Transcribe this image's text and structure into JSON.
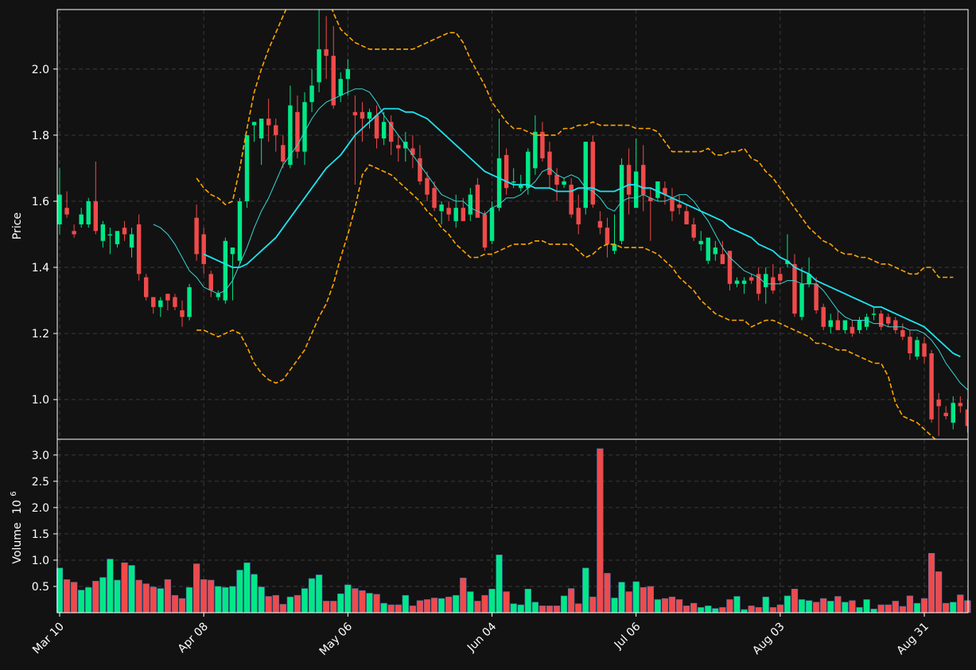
{
  "chart_data": {
    "type": "candlestick",
    "panels": {
      "price": {
        "ylabel": "Price",
        "ylim": [
          0.88,
          2.18
        ],
        "yticks": [
          1.0,
          1.2,
          1.4,
          1.6,
          1.8,
          2.0
        ],
        "ytick_labels": [
          "1.0",
          "1.2",
          "1.4",
          "1.6",
          "1.8",
          "2.0"
        ]
      },
      "volume": {
        "ylabel": "Volume",
        "ylabel_exponent": "6",
        "ylabel_base": "10",
        "ylim": [
          0,
          3.3
        ],
        "yticks": [
          0.5,
          1.0,
          1.5,
          2.0,
          2.5,
          3.0
        ],
        "ytick_labels": [
          "0.5",
          "1.0",
          "1.5",
          "2.0",
          "2.5",
          "3.0"
        ]
      }
    },
    "x_ticks": [
      {
        "index": 0,
        "label": "Mar 10"
      },
      {
        "index": 20,
        "label": "Apr 08"
      },
      {
        "index": 40,
        "label": "May 06"
      },
      {
        "index": 60,
        "label": "Jun 04"
      },
      {
        "index": 80,
        "label": "Jul 06"
      },
      {
        "index": 100,
        "label": "Aug 03"
      },
      {
        "index": 120,
        "label": "Aug 31"
      }
    ],
    "grid": true,
    "colors": {
      "background": "#121212",
      "up": "#00e887",
      "down": "#f04a4a",
      "ma_fast": "#38d5d5",
      "ma_slow": "#1ee3ee",
      "bands": "#ffa500",
      "grid": "#3a3a3a",
      "axis": "#ffffff"
    },
    "ohlc": [
      [
        1.53,
        1.7,
        1.5,
        1.62
      ],
      [
        1.58,
        1.63,
        1.55,
        1.56
      ],
      [
        1.51,
        1.53,
        1.49,
        1.5
      ],
      [
        1.53,
        1.58,
        1.52,
        1.56
      ],
      [
        1.53,
        1.61,
        1.52,
        1.6
      ],
      [
        1.6,
        1.72,
        1.5,
        1.51
      ],
      [
        1.48,
        1.54,
        1.46,
        1.53
      ],
      [
        1.5,
        1.52,
        1.44,
        1.5
      ],
      [
        1.47,
        1.51,
        1.46,
        1.51
      ],
      [
        1.52,
        1.54,
        1.48,
        1.5
      ],
      [
        1.46,
        1.52,
        1.43,
        1.5
      ],
      [
        1.53,
        1.56,
        1.36,
        1.38
      ],
      [
        1.37,
        1.38,
        1.3,
        1.31
      ],
      [
        1.31,
        1.31,
        1.26,
        1.28
      ],
      [
        1.28,
        1.31,
        1.25,
        1.3
      ],
      [
        1.32,
        1.32,
        1.27,
        1.3
      ],
      [
        1.31,
        1.32,
        1.27,
        1.28
      ],
      [
        1.27,
        1.3,
        1.22,
        1.25
      ],
      [
        1.25,
        1.35,
        1.24,
        1.34
      ],
      [
        1.55,
        1.59,
        1.42,
        1.44
      ],
      [
        1.5,
        1.52,
        1.38,
        1.41
      ],
      [
        1.38,
        1.39,
        1.31,
        1.33
      ],
      [
        1.31,
        1.33,
        1.3,
        1.32
      ],
      [
        1.3,
        1.49,
        1.29,
        1.48
      ],
      [
        1.44,
        1.46,
        1.3,
        1.46
      ],
      [
        1.42,
        1.61,
        1.41,
        1.6
      ],
      [
        1.6,
        1.8,
        1.58,
        1.8
      ],
      [
        1.83,
        1.84,
        1.78,
        1.84
      ],
      [
        1.79,
        1.85,
        1.71,
        1.85
      ],
      [
        1.85,
        1.91,
        1.78,
        1.83
      ],
      [
        1.83,
        1.85,
        1.75,
        1.8
      ],
      [
        1.77,
        1.8,
        1.7,
        1.72
      ],
      [
        1.71,
        1.95,
        1.7,
        1.89
      ],
      [
        1.87,
        1.92,
        1.73,
        1.75
      ],
      [
        1.75,
        1.93,
        1.71,
        1.9
      ],
      [
        1.9,
        2.0,
        1.87,
        1.95
      ],
      [
        1.96,
        2.2,
        1.93,
        2.06
      ],
      [
        2.06,
        2.16,
        1.97,
        2.04
      ],
      [
        2.04,
        2.13,
        1.88,
        1.89
      ],
      [
        1.92,
        1.99,
        1.9,
        1.97
      ],
      [
        1.97,
        2.03,
        1.92,
        2.0
      ],
      [
        1.87,
        1.92,
        1.65,
        1.86
      ],
      [
        1.87,
        1.9,
        1.78,
        1.85
      ],
      [
        1.85,
        1.88,
        1.82,
        1.87
      ],
      [
        1.86,
        1.89,
        1.76,
        1.79
      ],
      [
        1.79,
        1.87,
        1.77,
        1.84
      ],
      [
        1.84,
        1.86,
        1.74,
        1.78
      ],
      [
        1.77,
        1.8,
        1.72,
        1.76
      ],
      [
        1.76,
        1.81,
        1.72,
        1.78
      ],
      [
        1.76,
        1.8,
        1.7,
        1.74
      ],
      [
        1.73,
        1.77,
        1.65,
        1.66
      ],
      [
        1.67,
        1.69,
        1.6,
        1.62
      ],
      [
        1.64,
        1.66,
        1.57,
        1.58
      ],
      [
        1.57,
        1.6,
        1.53,
        1.59
      ],
      [
        1.58,
        1.6,
        1.54,
        1.56
      ],
      [
        1.54,
        1.62,
        1.52,
        1.58
      ],
      [
        1.58,
        1.61,
        1.54,
        1.54
      ],
      [
        1.56,
        1.64,
        1.54,
        1.62
      ],
      [
        1.65,
        1.67,
        1.55,
        1.55
      ],
      [
        1.56,
        1.57,
        1.45,
        1.46
      ],
      [
        1.48,
        1.6,
        1.47,
        1.58
      ],
      [
        1.58,
        1.85,
        1.57,
        1.73
      ],
      [
        1.74,
        1.76,
        1.62,
        1.64
      ],
      [
        1.66,
        1.7,
        1.64,
        1.66
      ],
      [
        1.64,
        1.68,
        1.63,
        1.65
      ],
      [
        1.64,
        1.76,
        1.62,
        1.75
      ],
      [
        1.7,
        1.86,
        1.68,
        1.81
      ],
      [
        1.81,
        1.84,
        1.72,
        1.73
      ],
      [
        1.75,
        1.78,
        1.64,
        1.68
      ],
      [
        1.68,
        1.7,
        1.6,
        1.65
      ],
      [
        1.65,
        1.67,
        1.64,
        1.66
      ],
      [
        1.65,
        1.67,
        1.55,
        1.56
      ],
      [
        1.58,
        1.62,
        1.5,
        1.53
      ],
      [
        1.58,
        1.78,
        1.56,
        1.78
      ],
      [
        1.78,
        1.8,
        1.58,
        1.59
      ],
      [
        1.54,
        1.57,
        1.5,
        1.52
      ],
      [
        1.52,
        1.55,
        1.43,
        1.47
      ],
      [
        1.45,
        1.56,
        1.44,
        1.47
      ],
      [
        1.48,
        1.73,
        1.47,
        1.71
      ],
      [
        1.71,
        1.76,
        1.56,
        1.62
      ],
      [
        1.58,
        1.79,
        1.58,
        1.69
      ],
      [
        1.71,
        1.77,
        1.57,
        1.62
      ],
      [
        1.61,
        1.64,
        1.48,
        1.6
      ],
      [
        1.61,
        1.66,
        1.6,
        1.66
      ],
      [
        1.64,
        1.66,
        1.59,
        1.62
      ],
      [
        1.61,
        1.64,
        1.54,
        1.57
      ],
      [
        1.59,
        1.62,
        1.56,
        1.58
      ],
      [
        1.57,
        1.59,
        1.53,
        1.53
      ],
      [
        1.53,
        1.55,
        1.48,
        1.49
      ],
      [
        1.47,
        1.51,
        1.45,
        1.48
      ],
      [
        1.42,
        1.47,
        1.41,
        1.49
      ],
      [
        1.44,
        1.48,
        1.42,
        1.46
      ],
      [
        1.44,
        1.48,
        1.42,
        1.41
      ],
      [
        1.45,
        1.45,
        1.33,
        1.35
      ],
      [
        1.35,
        1.37,
        1.34,
        1.36
      ],
      [
        1.35,
        1.37,
        1.32,
        1.36
      ],
      [
        1.37,
        1.38,
        1.35,
        1.36
      ],
      [
        1.38,
        1.4,
        1.3,
        1.32
      ],
      [
        1.34,
        1.4,
        1.29,
        1.38
      ],
      [
        1.37,
        1.41,
        1.32,
        1.33
      ],
      [
        1.38,
        1.4,
        1.35,
        1.36
      ],
      [
        1.41,
        1.5,
        1.4,
        1.42
      ],
      [
        1.41,
        1.44,
        1.25,
        1.26
      ],
      [
        1.25,
        1.4,
        1.24,
        1.35
      ],
      [
        1.35,
        1.43,
        1.34,
        1.38
      ],
      [
        1.35,
        1.37,
        1.26,
        1.27
      ],
      [
        1.28,
        1.29,
        1.21,
        1.22
      ],
      [
        1.22,
        1.26,
        1.2,
        1.24
      ],
      [
        1.24,
        1.27,
        1.21,
        1.21
      ],
      [
        1.21,
        1.24,
        1.2,
        1.24
      ],
      [
        1.22,
        1.24,
        1.19,
        1.2
      ],
      [
        1.21,
        1.25,
        1.2,
        1.24
      ],
      [
        1.22,
        1.26,
        1.21,
        1.25
      ],
      [
        1.26,
        1.28,
        1.24,
        1.26
      ],
      [
        1.26,
        1.27,
        1.21,
        1.22
      ],
      [
        1.25,
        1.26,
        1.22,
        1.23
      ],
      [
        1.24,
        1.25,
        1.2,
        1.21
      ],
      [
        1.21,
        1.23,
        1.18,
        1.19
      ],
      [
        1.19,
        1.21,
        1.12,
        1.14
      ],
      [
        1.13,
        1.19,
        1.12,
        1.18
      ],
      [
        1.17,
        1.19,
        1.11,
        1.13
      ],
      [
        1.14,
        1.15,
        0.93,
        0.94
      ],
      [
        1.0,
        1.02,
        0.89,
        0.98
      ],
      [
        0.96,
        0.98,
        0.94,
        0.95
      ],
      [
        0.93,
        1.01,
        0.91,
        0.99
      ],
      [
        0.99,
        1.01,
        0.96,
        0.98
      ],
      [
        0.97,
        1.0,
        0.9,
        0.92
      ]
    ],
    "volume": [
      0.85,
      0.63,
      0.58,
      0.43,
      0.48,
      0.6,
      0.67,
      1.02,
      0.62,
      0.95,
      0.9,
      0.62,
      0.55,
      0.49,
      0.46,
      0.63,
      0.33,
      0.27,
      0.48,
      0.93,
      0.63,
      0.62,
      0.5,
      0.48,
      0.5,
      0.81,
      0.95,
      0.73,
      0.49,
      0.31,
      0.33,
      0.16,
      0.3,
      0.33,
      0.46,
      0.65,
      0.72,
      0.22,
      0.22,
      0.36,
      0.53,
      0.46,
      0.42,
      0.37,
      0.35,
      0.18,
      0.15,
      0.15,
      0.33,
      0.13,
      0.23,
      0.25,
      0.28,
      0.27,
      0.3,
      0.33,
      0.66,
      0.4,
      0.22,
      0.33,
      0.45,
      1.1,
      0.4,
      0.17,
      0.15,
      0.45,
      0.2,
      0.13,
      0.13,
      0.13,
      0.32,
      0.46,
      0.17,
      0.85,
      0.3,
      3.12,
      0.75,
      0.28,
      0.58,
      0.4,
      0.59,
      0.48,
      0.5,
      0.25,
      0.27,
      0.3,
      0.25,
      0.13,
      0.18,
      0.1,
      0.13,
      0.08,
      0.1,
      0.25,
      0.31,
      0.06,
      0.13,
      0.1,
      0.3,
      0.1,
      0.15,
      0.32,
      0.45,
      0.25,
      0.23,
      0.2,
      0.27,
      0.22,
      0.31,
      0.2,
      0.23,
      0.1,
      0.25,
      0.07,
      0.15,
      0.15,
      0.22,
      0.12,
      0.32,
      0.18,
      0.27,
      1.13,
      0.78,
      0.18,
      0.2,
      0.34,
      0.23
    ],
    "ma_fast": [
      null,
      null,
      null,
      null,
      null,
      null,
      null,
      null,
      null,
      null,
      null,
      null,
      null,
      null,
      null,
      null,
      null,
      null,
      null,
      null,
      1.44,
      1.43,
      1.42,
      1.41,
      1.4,
      1.4,
      1.41,
      1.43,
      1.45,
      1.47,
      1.49,
      1.52,
      1.55,
      1.58,
      1.61,
      1.64,
      1.67,
      1.7,
      1.72,
      1.74,
      1.77,
      1.8,
      1.82,
      1.84,
      1.86,
      1.88,
      1.88,
      1.88,
      1.87,
      1.87,
      1.86,
      1.85,
      1.83,
      1.81,
      1.79,
      1.77,
      1.75,
      1.73,
      1.71,
      1.69,
      1.68,
      1.67,
      1.66,
      1.65,
      1.65,
      1.65,
      1.64,
      1.64,
      1.64,
      1.63,
      1.63,
      1.63,
      1.64,
      1.64,
      1.64,
      1.63,
      1.63,
      1.63,
      1.64,
      1.65,
      1.65,
      1.64,
      1.64,
      1.63,
      1.62,
      1.61,
      1.6,
      1.59,
      1.58,
      1.57,
      1.56,
      1.55,
      1.54,
      1.52,
      1.51,
      1.5,
      1.49,
      1.47,
      1.46,
      1.45,
      1.43,
      1.42,
      1.4,
      1.39,
      1.38,
      1.36,
      1.35,
      1.34,
      1.33,
      1.32,
      1.31,
      1.3,
      1.29,
      1.28,
      1.28,
      1.27,
      1.26,
      1.25,
      1.24,
      1.23,
      1.22,
      1.2,
      1.18,
      1.16,
      1.14,
      1.13
    ],
    "ma_slow": [
      null,
      null,
      null,
      null,
      null,
      null,
      null,
      null,
      null,
      null,
      null,
      null,
      null,
      1.53,
      1.52,
      1.5,
      1.47,
      1.43,
      1.39,
      1.37,
      1.34,
      1.33,
      1.32,
      1.33,
      1.36,
      1.41,
      1.46,
      1.52,
      1.57,
      1.61,
      1.66,
      1.71,
      1.74,
      1.77,
      1.81,
      1.85,
      1.88,
      1.9,
      1.91,
      1.92,
      1.93,
      1.94,
      1.94,
      1.93,
      1.9,
      1.86,
      1.83,
      1.8,
      1.77,
      1.74,
      1.71,
      1.68,
      1.65,
      1.62,
      1.61,
      1.6,
      1.6,
      1.58,
      1.57,
      1.56,
      1.58,
      1.59,
      1.61,
      1.61,
      1.62,
      1.64,
      1.66,
      1.69,
      1.7,
      1.68,
      1.67,
      1.68,
      1.67,
      1.64,
      1.63,
      1.61,
      1.58,
      1.57,
      1.6,
      1.61,
      1.61,
      1.62,
      1.61,
      1.6,
      1.6,
      1.61,
      1.62,
      1.62,
      1.6,
      1.57,
      1.54,
      1.5,
      1.46,
      1.43,
      1.41,
      1.39,
      1.38,
      1.37,
      1.35,
      1.35,
      1.35,
      1.36,
      1.36,
      1.35,
      1.35,
      1.35,
      1.33,
      1.3,
      1.27,
      1.25,
      1.24,
      1.24,
      1.24,
      1.23,
      1.23,
      1.22,
      1.22,
      1.22,
      1.21,
      1.21,
      1.2,
      1.18,
      1.15,
      1.11,
      1.08,
      1.05,
      1.03,
      1.03
    ],
    "band_upper": [
      null,
      null,
      null,
      null,
      null,
      null,
      null,
      null,
      null,
      null,
      null,
      null,
      null,
      null,
      null,
      null,
      null,
      null,
      null,
      1.67,
      1.64,
      1.62,
      1.61,
      1.59,
      1.6,
      1.7,
      1.82,
      1.93,
      2.0,
      2.06,
      2.11,
      2.16,
      2.21,
      2.25,
      2.27,
      2.28,
      2.27,
      2.23,
      2.17,
      2.12,
      2.1,
      2.08,
      2.07,
      2.06,
      2.06,
      2.06,
      2.06,
      2.06,
      2.06,
      2.06,
      2.07,
      2.08,
      2.09,
      2.1,
      2.11,
      2.11,
      2.08,
      2.03,
      1.99,
      1.95,
      1.9,
      1.87,
      1.84,
      1.82,
      1.82,
      1.81,
      1.8,
      1.8,
      1.8,
      1.8,
      1.82,
      1.82,
      1.83,
      1.83,
      1.84,
      1.83,
      1.83,
      1.83,
      1.83,
      1.83,
      1.82,
      1.82,
      1.82,
      1.81,
      1.78,
      1.75,
      1.75,
      1.75,
      1.75,
      1.75,
      1.76,
      1.74,
      1.74,
      1.75,
      1.75,
      1.76,
      1.73,
      1.72,
      1.69,
      1.67,
      1.64,
      1.61,
      1.58,
      1.55,
      1.52,
      1.5,
      1.48,
      1.47,
      1.45,
      1.44,
      1.44,
      1.43,
      1.43,
      1.42,
      1.41,
      1.41,
      1.4,
      1.39,
      1.38,
      1.38,
      1.4,
      1.4,
      1.37,
      1.37,
      1.37
    ],
    "band_lower": [
      null,
      null,
      null,
      null,
      null,
      null,
      null,
      null,
      null,
      null,
      null,
      null,
      null,
      null,
      null,
      null,
      null,
      null,
      null,
      1.21,
      1.21,
      1.2,
      1.19,
      1.2,
      1.21,
      1.2,
      1.16,
      1.11,
      1.08,
      1.06,
      1.05,
      1.06,
      1.09,
      1.12,
      1.15,
      1.2,
      1.25,
      1.29,
      1.35,
      1.43,
      1.5,
      1.58,
      1.68,
      1.71,
      1.7,
      1.69,
      1.68,
      1.66,
      1.64,
      1.62,
      1.6,
      1.57,
      1.55,
      1.52,
      1.5,
      1.47,
      1.45,
      1.43,
      1.43,
      1.44,
      1.44,
      1.45,
      1.46,
      1.47,
      1.47,
      1.47,
      1.48,
      1.48,
      1.47,
      1.47,
      1.47,
      1.47,
      1.45,
      1.43,
      1.44,
      1.46,
      1.47,
      1.47,
      1.46,
      1.46,
      1.46,
      1.46,
      1.45,
      1.44,
      1.42,
      1.4,
      1.37,
      1.35,
      1.33,
      1.3,
      1.28,
      1.26,
      1.25,
      1.24,
      1.24,
      1.24,
      1.22,
      1.23,
      1.24,
      1.24,
      1.23,
      1.22,
      1.21,
      1.2,
      1.19,
      1.17,
      1.17,
      1.16,
      1.15,
      1.15,
      1.14,
      1.13,
      1.12,
      1.11,
      1.11,
      1.07,
      0.99,
      0.95,
      0.94,
      0.93,
      0.91,
      0.89,
      0.87,
      0.86,
      0.86,
      0.85,
      0.85
    ]
  }
}
